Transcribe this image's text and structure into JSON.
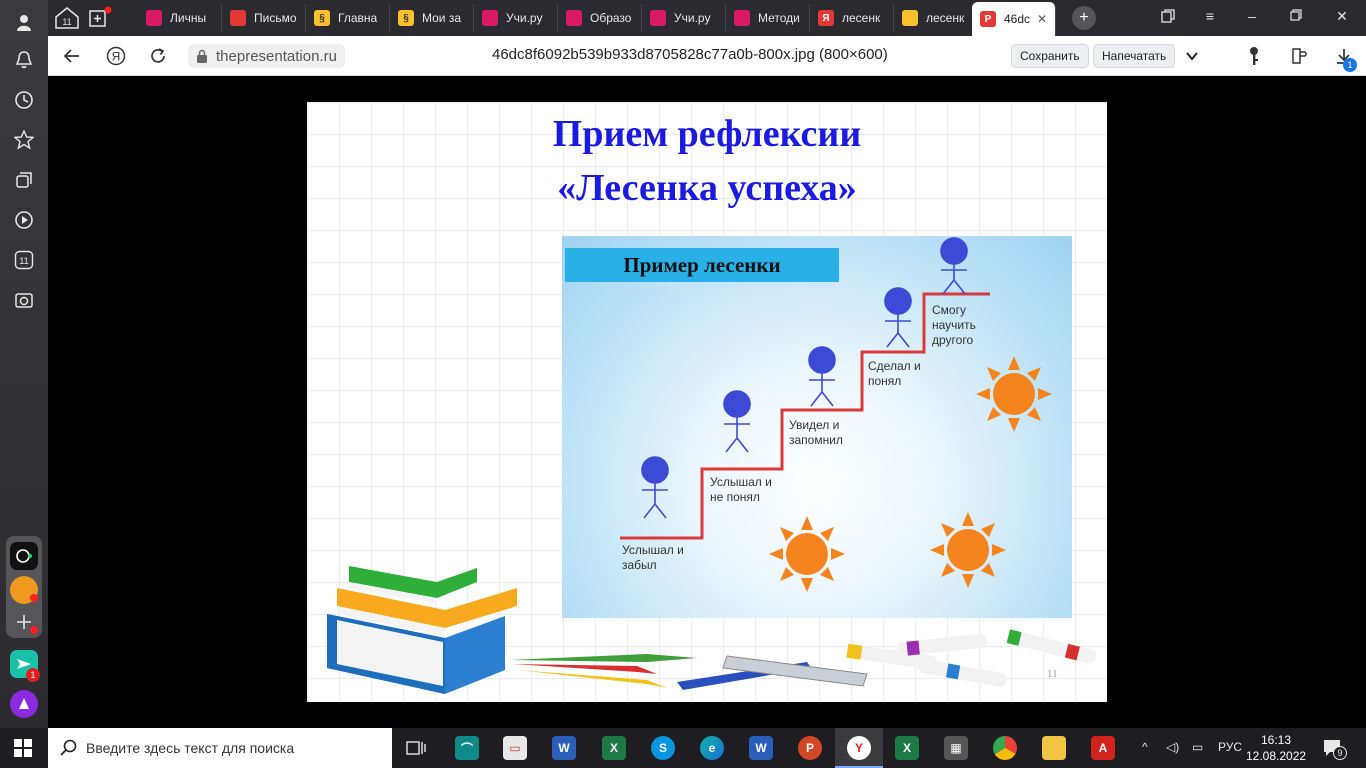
{
  "browser": {
    "tabs": [
      {
        "label": "Личны",
        "fav_color": "#d81b60"
      },
      {
        "label": "Письмо",
        "fav_color": "#e53935"
      },
      {
        "label": "Главна",
        "fav_color": "#fbc02d"
      },
      {
        "label": "Мои за",
        "fav_color": "#fbc02d"
      },
      {
        "label": "Учи.ру",
        "fav_color": "#d81b60"
      },
      {
        "label": "Образо",
        "fav_color": "#d81b60"
      },
      {
        "label": "Учи.ру",
        "fav_color": "#d81b60"
      },
      {
        "label": "Методи",
        "fav_color": "#d81b60"
      },
      {
        "label": "лесенк",
        "fav_color": "#e53935"
      },
      {
        "label": "лесенк",
        "fav_color": "#fbc02d"
      },
      {
        "label": "46dc",
        "fav_color": "#e53935",
        "active": true
      }
    ],
    "domain": "thepresentation.ru",
    "page_title": "46dc8f6092b539b933d8705828c77a0b-800x.jpg (800×600)",
    "save_label": "Сохранить",
    "print_label": "Напечатать",
    "download_badge": "1",
    "sidebar_badge": "1",
    "tabs_counter": "11"
  },
  "slide": {
    "title_line1": "Прием рефлексии",
    "title_line2": "«Лесенка успеха»",
    "panel_label": "Пример лесенки",
    "steps": [
      "Услышал и\nзабыл",
      "Услышал и\nне понял",
      "Увидел и\nзапомнил",
      "Сделал и\nпонял",
      "Смогу\nнаучить\nдругого"
    ],
    "page_number": "11"
  },
  "taskbar": {
    "search_placeholder": "Введите здесь текст для поиска",
    "language": "РУС",
    "time": "16:13",
    "date": "12.08.2022",
    "notification_count": "9"
  },
  "colors": {
    "title_blue": "#1a1ae0",
    "panel_label_bg": "#29b0e6",
    "ladder_red": "#d93b3b",
    "figure_blue": "#3d4ad6",
    "sun_orange": "#f5841f"
  }
}
